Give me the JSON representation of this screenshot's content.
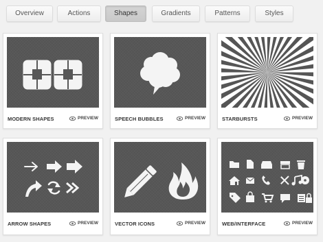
{
  "tabs": [
    {
      "label": "Overview",
      "active": false
    },
    {
      "label": "Actions",
      "active": false
    },
    {
      "label": "Shapes",
      "active": true
    },
    {
      "label": "Gradients",
      "active": false
    },
    {
      "label": "Patterns",
      "active": false
    },
    {
      "label": "Styles",
      "active": false
    }
  ],
  "preview_label": "PREVIEW",
  "cards": [
    {
      "title": "MODERN SHAPES",
      "icon": "modern-shapes-icon"
    },
    {
      "title": "SPEECH BUBBLES",
      "icon": "speech-bubble-icon"
    },
    {
      "title": "STARBURSTS",
      "icon": "starburst-icon"
    },
    {
      "title": "ARROW SHAPES",
      "icon": "arrow-shapes-icon"
    },
    {
      "title": "VECTOR ICONS",
      "icon": "pencil-and-flame-icon"
    },
    {
      "title": "WEB/INTERFACE",
      "icon": "web-interface-icons"
    }
  ]
}
